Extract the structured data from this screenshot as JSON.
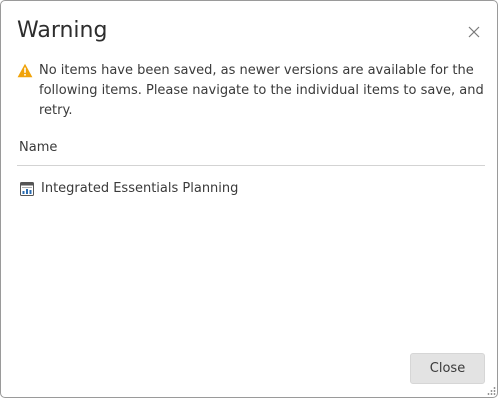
{
  "dialog": {
    "title": "Warning",
    "message": "No items have been saved, as newer versions are available for the following items. Please navigate to the individual items to save, and retry.",
    "column_header": "Name",
    "items": [
      {
        "label": "Integrated Essentials Planning",
        "icon": "planning-report-icon"
      }
    ],
    "close_button_label": "Close",
    "close_icon": "close-icon",
    "warning_icon": "warning-triangle-icon",
    "resize_icon": "resize-grip-icon"
  },
  "colors": {
    "warning": "#f0a30a",
    "icon_blue": "#2b6cb0",
    "button_bg": "#e3e3e3",
    "divider": "#d3d3d3",
    "border": "#9a9a9a"
  }
}
